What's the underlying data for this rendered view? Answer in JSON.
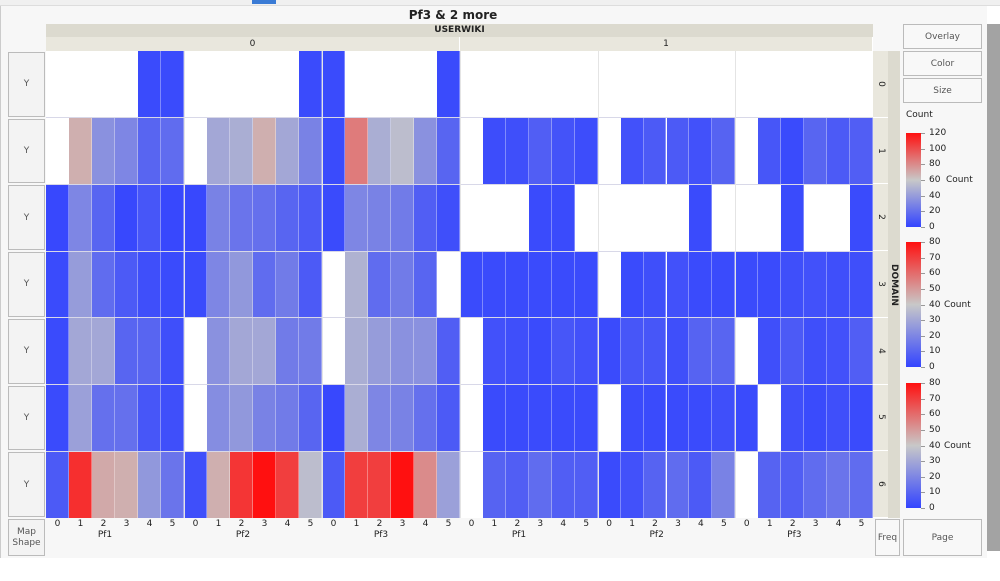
{
  "title": "Pf3 & 2 more",
  "buttons": {
    "overlay": "Overlay",
    "color": "Color",
    "size": "Size",
    "map_shape": "Map Shape",
    "freq": "Freq",
    "page": "Page",
    "y": "Y"
  },
  "colors": {
    "low": "#3344ff",
    "mid": "#c8c8c8",
    "high": "#ff1010",
    "header_band": "#dcdacf",
    "sub_band": "#e9e7dd"
  },
  "chart_data": {
    "type": "heatmap",
    "title": "Pf3 & 2 more",
    "column_group_label": "USERWIKI",
    "column_groups": [
      "0",
      "1"
    ],
    "sub_groups": [
      "Pf1",
      "Pf2",
      "Pf3"
    ],
    "levels": [
      "0",
      "1",
      "2",
      "3",
      "4",
      "5"
    ],
    "row_group_label": "DOMAIN",
    "rows": [
      "0",
      "1",
      "2",
      "3",
      "4",
      "5",
      "6"
    ],
    "color_label": "Count",
    "color_range": [
      0,
      120
    ],
    "legends": [
      {
        "title": "Count",
        "ticks": [
          "120",
          "100",
          "80",
          "60",
          "40",
          "20",
          "0"
        ],
        "mid_label": "Count"
      },
      {
        "title": "",
        "ticks": [
          "80",
          "70",
          "60",
          "50",
          "40",
          "30",
          "20",
          "10",
          "0"
        ],
        "mid_label": "Count"
      },
      {
        "title": "",
        "ticks": [
          "80",
          "70",
          "60",
          "50",
          "40",
          "30",
          "20",
          "10",
          "0"
        ],
        "mid_label": "Count"
      }
    ],
    "values": [
      [
        null,
        null,
        null,
        null,
        3,
        3,
        null,
        null,
        null,
        null,
        null,
        3,
        3,
        null,
        null,
        null,
        null,
        3,
        null,
        null,
        null,
        null,
        null,
        null,
        null,
        null,
        null,
        null,
        null,
        null,
        null,
        null,
        null,
        null,
        null,
        null
      ],
      [
        null,
        68,
        35,
        30,
        15,
        18,
        null,
        45,
        48,
        68,
        45,
        28,
        3,
        85,
        48,
        55,
        35,
        15,
        null,
        4,
        5,
        12,
        7,
        4,
        null,
        6,
        10,
        10,
        6,
        14,
        null,
        8,
        3,
        15,
        10,
        12
      ],
      [
        2,
        30,
        15,
        2,
        8,
        2,
        2,
        28,
        22,
        20,
        15,
        10,
        3,
        30,
        28,
        25,
        12,
        5,
        null,
        null,
        null,
        3,
        3,
        null,
        null,
        null,
        null,
        null,
        3,
        null,
        null,
        null,
        3,
        null,
        null,
        3
      ],
      [
        3,
        40,
        18,
        10,
        5,
        3,
        3,
        30,
        38,
        18,
        25,
        10,
        null,
        50,
        18,
        25,
        15,
        null,
        3,
        3,
        3,
        3,
        3,
        3,
        null,
        3,
        5,
        6,
        3,
        3,
        3,
        3,
        5,
        6,
        5,
        5
      ],
      [
        3,
        45,
        45,
        15,
        15,
        5,
        null,
        35,
        45,
        45,
        25,
        25,
        null,
        48,
        40,
        35,
        35,
        12,
        null,
        6,
        5,
        3,
        8,
        6,
        3,
        8,
        8,
        5,
        14,
        15,
        null,
        5,
        10,
        5,
        6,
        12
      ],
      [
        3,
        42,
        20,
        20,
        8,
        5,
        null,
        33,
        38,
        28,
        25,
        15,
        2,
        48,
        30,
        28,
        20,
        10,
        null,
        3,
        3,
        3,
        3,
        3,
        null,
        3,
        3,
        3,
        3,
        5,
        3,
        null,
        5,
        3,
        5,
        3
      ],
      [
        10,
        110,
        70,
        68,
        38,
        22,
        5,
        68,
        108,
        120,
        105,
        55,
        10,
        105,
        105,
        120,
        80,
        42,
        null,
        14,
        12,
        18,
        12,
        12,
        3,
        6,
        14,
        18,
        10,
        28,
        null,
        14,
        12,
        18,
        22,
        18
      ]
    ]
  }
}
